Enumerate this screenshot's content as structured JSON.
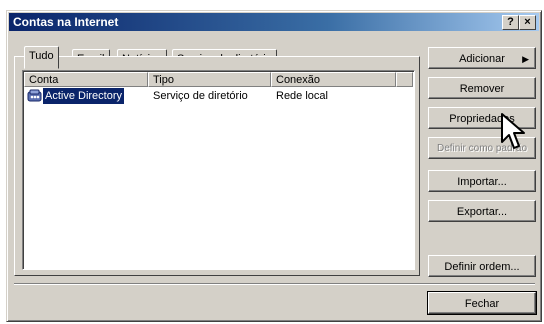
{
  "window": {
    "title": "Contas na Internet",
    "help_label": "?",
    "close_label": "×"
  },
  "tabs": [
    {
      "label": "Tudo",
      "selected": true
    },
    {
      "label": "Email",
      "selected": false
    },
    {
      "label": "Notícias",
      "selected": false
    },
    {
      "label": "Serviço de diretório",
      "selected": false
    }
  ],
  "list": {
    "columns": [
      "Conta",
      "Tipo",
      "Conexão"
    ],
    "rows": [
      {
        "icon": "directory-service-icon",
        "conta": "Active Directory",
        "tipo": "Serviço de diretório",
        "conexao": "Rede local",
        "selected": true
      }
    ]
  },
  "buttons": {
    "adicionar": "Adicionar",
    "remover": "Remover",
    "propriedades": "Propriedades",
    "definir_padrao": "Definir como padrão",
    "importar": "Importar...",
    "exportar": "Exportar...",
    "definir_ordem": "Definir ordem...",
    "fechar": "Fechar"
  },
  "colors": {
    "selection": "#0a246a",
    "face": "#d4d0c8",
    "titlebar": "#0a246a"
  }
}
